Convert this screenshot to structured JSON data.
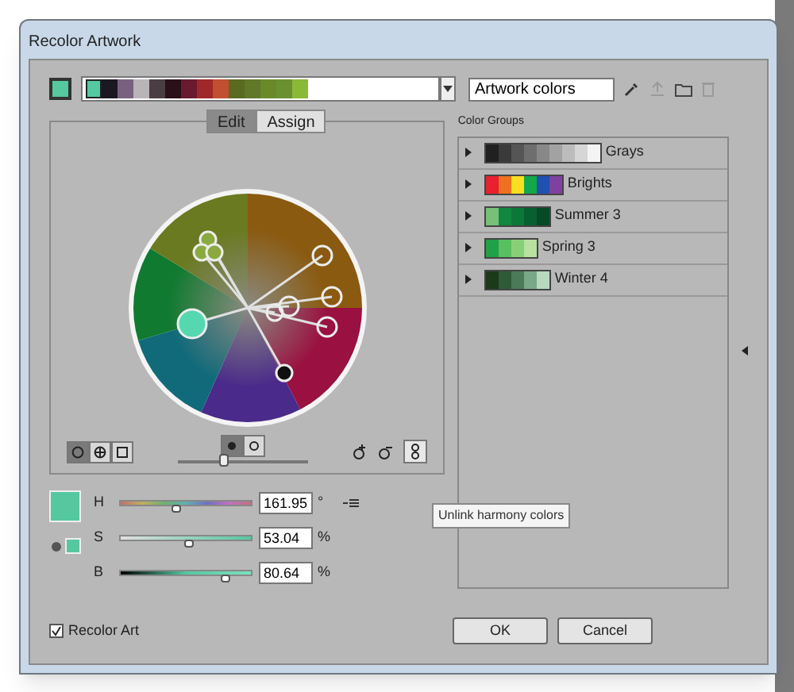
{
  "window": {
    "title": "Recolor Artwork"
  },
  "artwork_strip": {
    "swatches": [
      {
        "color": "#55c8a0"
      },
      {
        "color": "#1a1820"
      },
      {
        "color": "#7a6080"
      },
      {
        "color": "#b8b4b8"
      },
      {
        "color": "#4a3e44"
      },
      {
        "color": "#2a1018"
      },
      {
        "color": "#6a1a30"
      },
      {
        "color": "#a02828"
      },
      {
        "color": "#c05030"
      },
      {
        "color": "#5a6a20"
      },
      {
        "color": "#607828"
      },
      {
        "color": "#6a8a2a"
      },
      {
        "color": "#6a9030"
      },
      {
        "color": "#8ab838"
      }
    ]
  },
  "group_name": {
    "value": "Artwork colors"
  },
  "tabs": [
    {
      "label": "Edit",
      "selected": true
    },
    {
      "label": "Assign",
      "selected": false
    }
  ],
  "wheel_modes": [
    {
      "kind": "smooth",
      "selected": true
    },
    {
      "kind": "segmented",
      "selected": false
    },
    {
      "kind": "bars",
      "selected": false
    }
  ],
  "wheel_display": [
    {
      "kind": "brightness",
      "selected": true
    },
    {
      "kind": "saturation",
      "selected": false
    }
  ],
  "wheel_slider": {
    "level": 0.35
  },
  "sliders": [
    {
      "label": "H",
      "value": "161.95",
      "unit": "°",
      "level": 0.43,
      "kind": "hue"
    },
    {
      "label": "S",
      "value": "53.04",
      "unit": "%",
      "level": 0.53,
      "kind": "sat"
    },
    {
      "label": "B",
      "value": "80.64",
      "unit": "%",
      "level": 0.8,
      "kind": "bright"
    }
  ],
  "tooltip": "Unlink harmony colors",
  "color_groups_label": "Color Groups",
  "color_groups": [
    {
      "name": "Grays",
      "swatches": [
        {
          "color": "#202020"
        },
        {
          "color": "#3a3a3a"
        },
        {
          "color": "#555555"
        },
        {
          "color": "#6e6e6e"
        },
        {
          "color": "#888888"
        },
        {
          "color": "#a2a2a2"
        },
        {
          "color": "#bcbcbc"
        },
        {
          "color": "#d6d6d6"
        },
        {
          "color": "#f4f4f4"
        }
      ]
    },
    {
      "name": "Brights",
      "swatches": [
        {
          "color": "#e82030"
        },
        {
          "color": "#f07020"
        },
        {
          "color": "#f8e020"
        },
        {
          "color": "#10a848"
        },
        {
          "color": "#2050b0"
        },
        {
          "color": "#8040a0"
        }
      ]
    },
    {
      "name": "Summer 3",
      "swatches": [
        {
          "color": "#78c078"
        },
        {
          "color": "#108840"
        },
        {
          "color": "#0a7838"
        },
        {
          "color": "#086030"
        },
        {
          "color": "#064a28"
        }
      ]
    },
    {
      "name": "Spring 3",
      "swatches": [
        {
          "color": "#20a048"
        },
        {
          "color": "#58c060"
        },
        {
          "color": "#88d078"
        },
        {
          "color": "#b8e0a0"
        }
      ]
    },
    {
      "name": "Winter 4",
      "swatches": [
        {
          "color": "#1a3a1a"
        },
        {
          "color": "#2e5a3a"
        },
        {
          "color": "#4a7a58"
        },
        {
          "color": "#78a888"
        },
        {
          "color": "#b8d8c0"
        }
      ]
    }
  ],
  "recolor_art": {
    "label": "Recolor Art",
    "checked": true
  },
  "buttons": [
    "OK",
    "Cancel"
  ]
}
